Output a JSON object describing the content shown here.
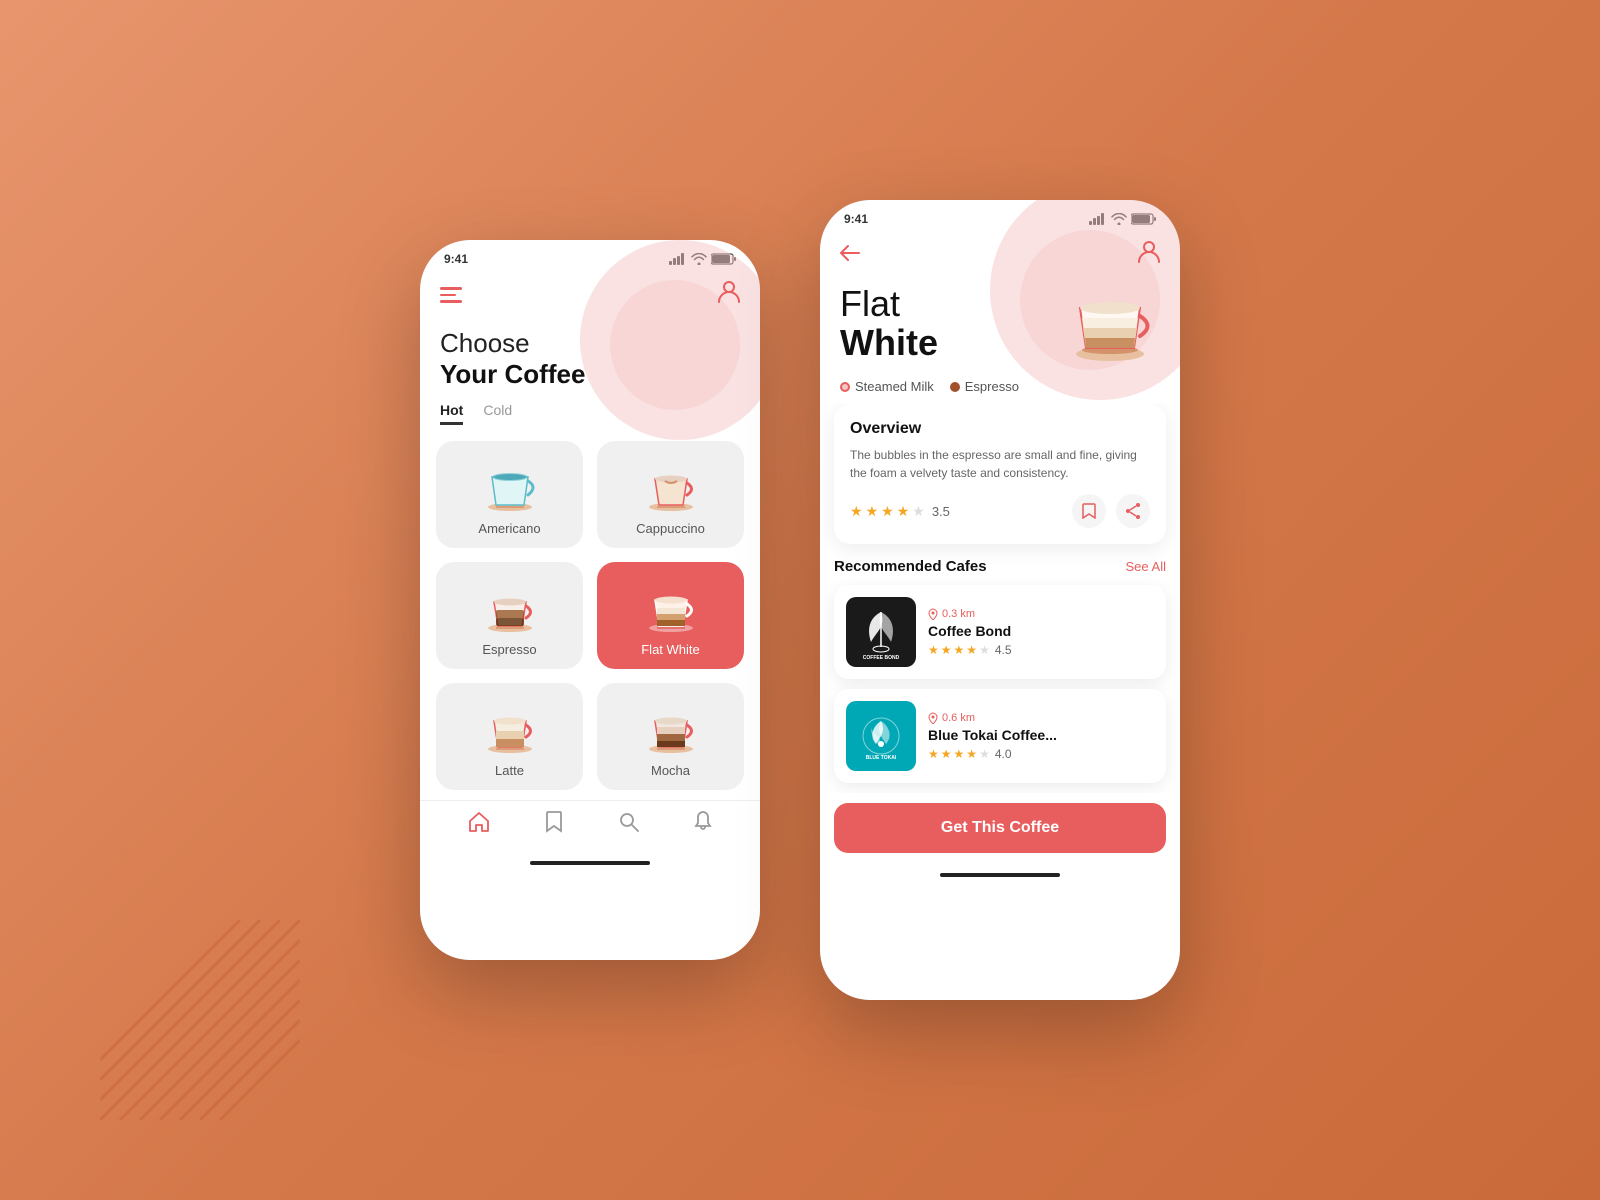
{
  "background": {
    "color": "#d4784a"
  },
  "phone_left": {
    "status_time": "9:41",
    "title_line1": "Choose",
    "title_line2": "Your Coffee",
    "filter_hot": "Hot",
    "filter_cold": "Cold",
    "coffees": [
      {
        "name": "Americano",
        "color": "teal",
        "selected": false
      },
      {
        "name": "Cappuccino",
        "color": "cream",
        "selected": false
      },
      {
        "name": "Espresso",
        "color": "dark",
        "selected": false
      },
      {
        "name": "Flat White",
        "color": "layered",
        "selected": true
      },
      {
        "name": "Latte",
        "color": "latte",
        "selected": false
      },
      {
        "name": "Mocha",
        "color": "mocha",
        "selected": false
      }
    ],
    "nav": {
      "home": "home",
      "bookmark": "bookmark",
      "search": "search",
      "bell": "bell"
    }
  },
  "phone_right": {
    "status_time": "9:41",
    "coffee_name_line1": "Flat",
    "coffee_name_line2": "White",
    "ingredients": [
      {
        "name": "Steamed Milk",
        "type": "light"
      },
      {
        "name": "Espresso",
        "type": "dark"
      }
    ],
    "overview": {
      "title": "Overview",
      "description": "The bubbles in the espresso are small and fine, giving the foam a velvety taste and consistency.",
      "rating": "3.5",
      "rating_num": 3.5
    },
    "recommended_title": "Recommended Cafes",
    "see_all": "See All",
    "cafes": [
      {
        "name": "Coffee Bond",
        "distance": "0.3 km",
        "rating": "4.5",
        "logo_type": "black",
        "logo_text": "COFFEE BOND"
      },
      {
        "name": "Blue Tokai Coffee...",
        "distance": "0.6 km",
        "rating": "4.0",
        "logo_type": "teal",
        "logo_text": "BLUE TOKAI"
      }
    ],
    "get_coffee_btn": "Get This Coffee"
  }
}
